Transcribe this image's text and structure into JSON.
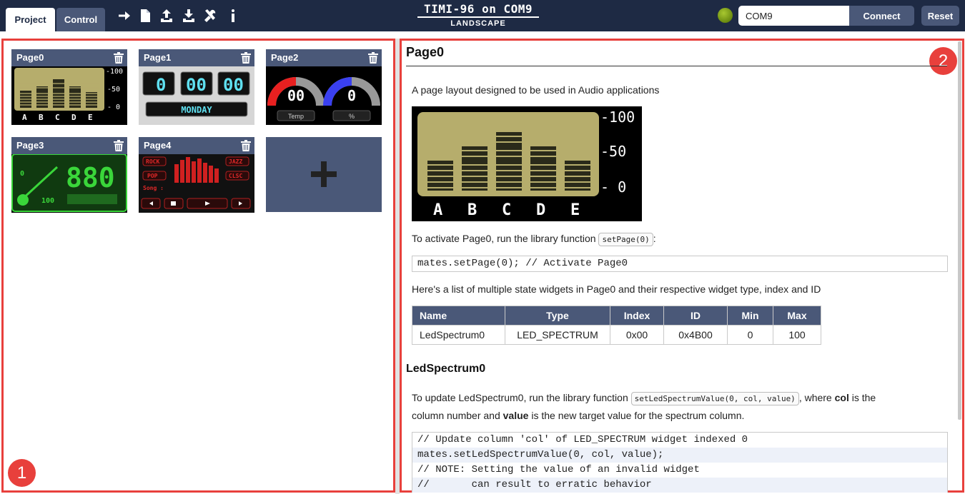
{
  "tabs": [
    {
      "label": "Project",
      "active": true
    },
    {
      "label": "Control",
      "active": false
    }
  ],
  "toolbar_icons": [
    "arrow-right-icon",
    "new-file-icon",
    "upload-icon",
    "download-icon",
    "tools-icon",
    "info-icon"
  ],
  "brand": {
    "title": "TIMI-96 on COM9",
    "subtitle": "LANDSCAPE"
  },
  "connection": {
    "port_value": "COM9",
    "connect_label": "Connect",
    "reset_label": "Reset",
    "status_color": "#8aa81c"
  },
  "markers": [
    "1",
    "2"
  ],
  "pages": [
    {
      "name": "Page0",
      "kind": "spectrum",
      "scale": [
        "-100",
        "-50",
        "- 0"
      ],
      "columns": [
        "A",
        "B",
        "C",
        "D",
        "E"
      ]
    },
    {
      "name": "Page1",
      "kind": "clock",
      "digits": [
        "0",
        "00",
        "00"
      ],
      "day": "MONDAY"
    },
    {
      "name": "Page2",
      "kind": "gauges",
      "gauge_values": [
        "00",
        "0"
      ],
      "gauge_labels": [
        "Temp",
        "%"
      ]
    },
    {
      "name": "Page3",
      "kind": "meter",
      "meter_labels": [
        "0",
        "100"
      ],
      "digits": "880"
    },
    {
      "name": "Page4",
      "kind": "player",
      "buttons": [
        "ROCK",
        "POP",
        "JAZZ",
        "CLSC"
      ],
      "song_label": "Song :"
    }
  ],
  "doc": {
    "title": "Page0",
    "intro": "A page layout designed to be used in Audio applications",
    "preview": {
      "scale": [
        "-100",
        "-50",
        "- 0"
      ],
      "columns": [
        "A",
        "B",
        "C",
        "D",
        "E"
      ]
    },
    "activate_text": "To activate Page0, run the library function",
    "activate_fn": "setPage(0)",
    "activate_suffix": ":",
    "activate_code": "mates.setPage(0); // Activate Page0",
    "list_text": "Here's a list of multiple state widgets in Page0 and their respective widget type, index and ID",
    "table": {
      "headers": [
        "Name",
        "Type",
        "Index",
        "ID",
        "Min",
        "Max"
      ],
      "rows": [
        [
          "LedSpectrum0",
          "LED_SPECTRUM",
          "0x00",
          "0x4B00",
          "0",
          "100"
        ]
      ]
    },
    "widget_title": "LedSpectrum0",
    "update_text_1": "To update LedSpectrum0, run the library function",
    "update_fn": "setLedSpectrumValue(0, col, value)",
    "update_text_2": ", where",
    "col_word": "col",
    "update_text_3": "is the",
    "update_line2_a": "column number and",
    "value_word": "value",
    "update_line2_b": "is the new target value for the spectrum column.",
    "code_lines": [
      "// Update column 'col' of LED_SPECTRUM widget indexed 0",
      "mates.setLedSpectrumValue(0, col, value);",
      "// NOTE: Setting the value of an invalid widget",
      "//       can result to erratic behavior"
    ]
  }
}
